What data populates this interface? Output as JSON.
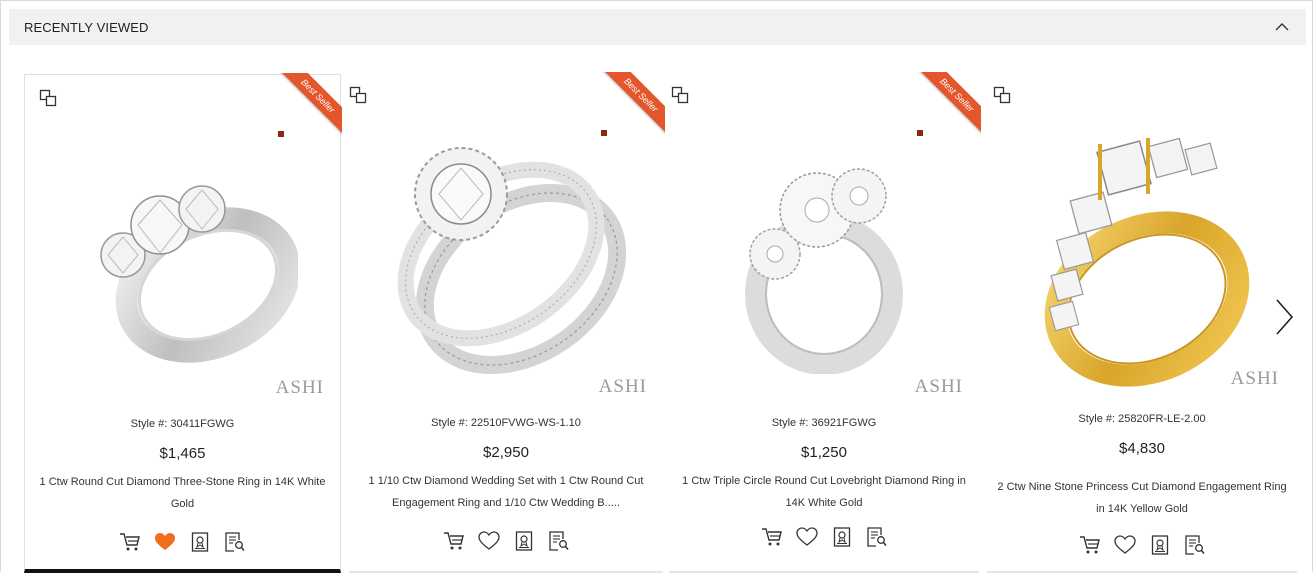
{
  "section": {
    "title": "RECENTLY VIEWED"
  },
  "colors": {
    "ribbon": "#e4562b",
    "wishlist_active": "#f06d1e",
    "gold": "#e8b93a"
  },
  "products": [
    {
      "style": "Style #: 30411FGWG",
      "price": "$1,465",
      "name": "1 Ctw Round Cut Diamond Three-Stone Ring in 14K White Gold",
      "badge": "Best Seller",
      "brand": "ASHI",
      "metal": "white",
      "wishlisted": true
    },
    {
      "style": "Style #: 22510FVWG-WS-1.10",
      "price": "$2,950",
      "name": "1 1/10 Ctw Diamond Wedding Set with 1 Ctw Round Cut Engagement Ring and 1/10 Ctw Wedding B.....",
      "badge": "Best Seller",
      "brand": "ASHI",
      "metal": "white",
      "wishlisted": false
    },
    {
      "style": "Style #: 36921FGWG",
      "price": "$1,250",
      "name": "1 Ctw Triple Circle Round Cut Lovebright Diamond Ring in 14K White Gold",
      "badge": "Best Seller",
      "brand": "ASHI",
      "metal": "white",
      "wishlisted": false
    },
    {
      "style": "Style #: 25820FR-LE-2.00",
      "price": "$4,830",
      "name": "2 Ctw Nine Stone Princess Cut Diamond Engagement Ring in 14K Yellow Gold",
      "badge": "",
      "brand": "ASHI",
      "metal": "yellow",
      "wishlisted": false
    }
  ],
  "icons": {
    "compare": "compare-icon",
    "cart": "cart-icon",
    "wishlist": "heart-icon",
    "details": "certificate-icon",
    "quick_view": "quick-view-icon",
    "prev": "chevron-left-icon",
    "next": "chevron-right-icon",
    "collapse": "chevron-up-icon"
  }
}
